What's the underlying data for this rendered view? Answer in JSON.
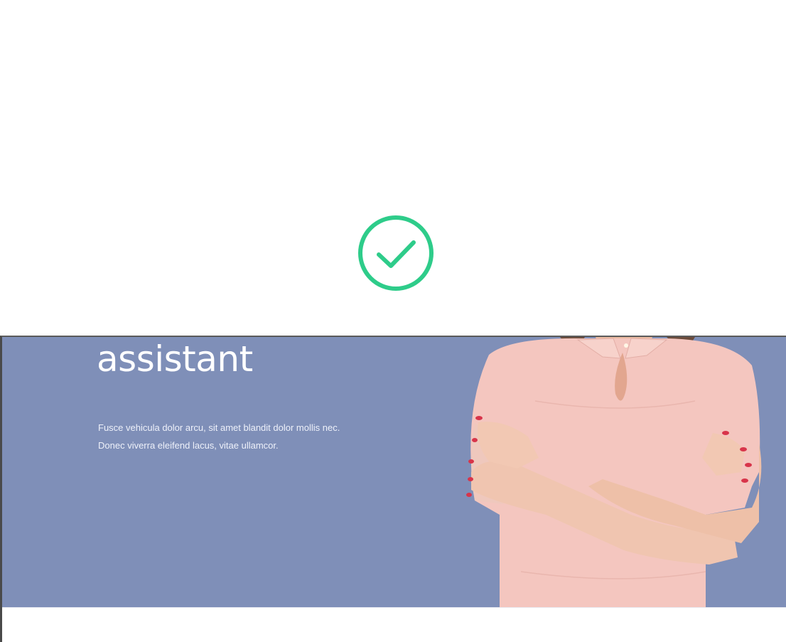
{
  "status": {
    "icon": "check-circle-icon",
    "color": "#2ecc8a"
  },
  "hero": {
    "background": "#7f8fb8",
    "title_lines": [
      "assistant"
    ],
    "description_lines": [
      "Fusce vehicula dolor arcu, sit amet blandit dolor mollis nec.",
      "Donec viverra eleifend lacus, vitae ullamcor."
    ],
    "image": "woman-crossed-arms-photo"
  }
}
